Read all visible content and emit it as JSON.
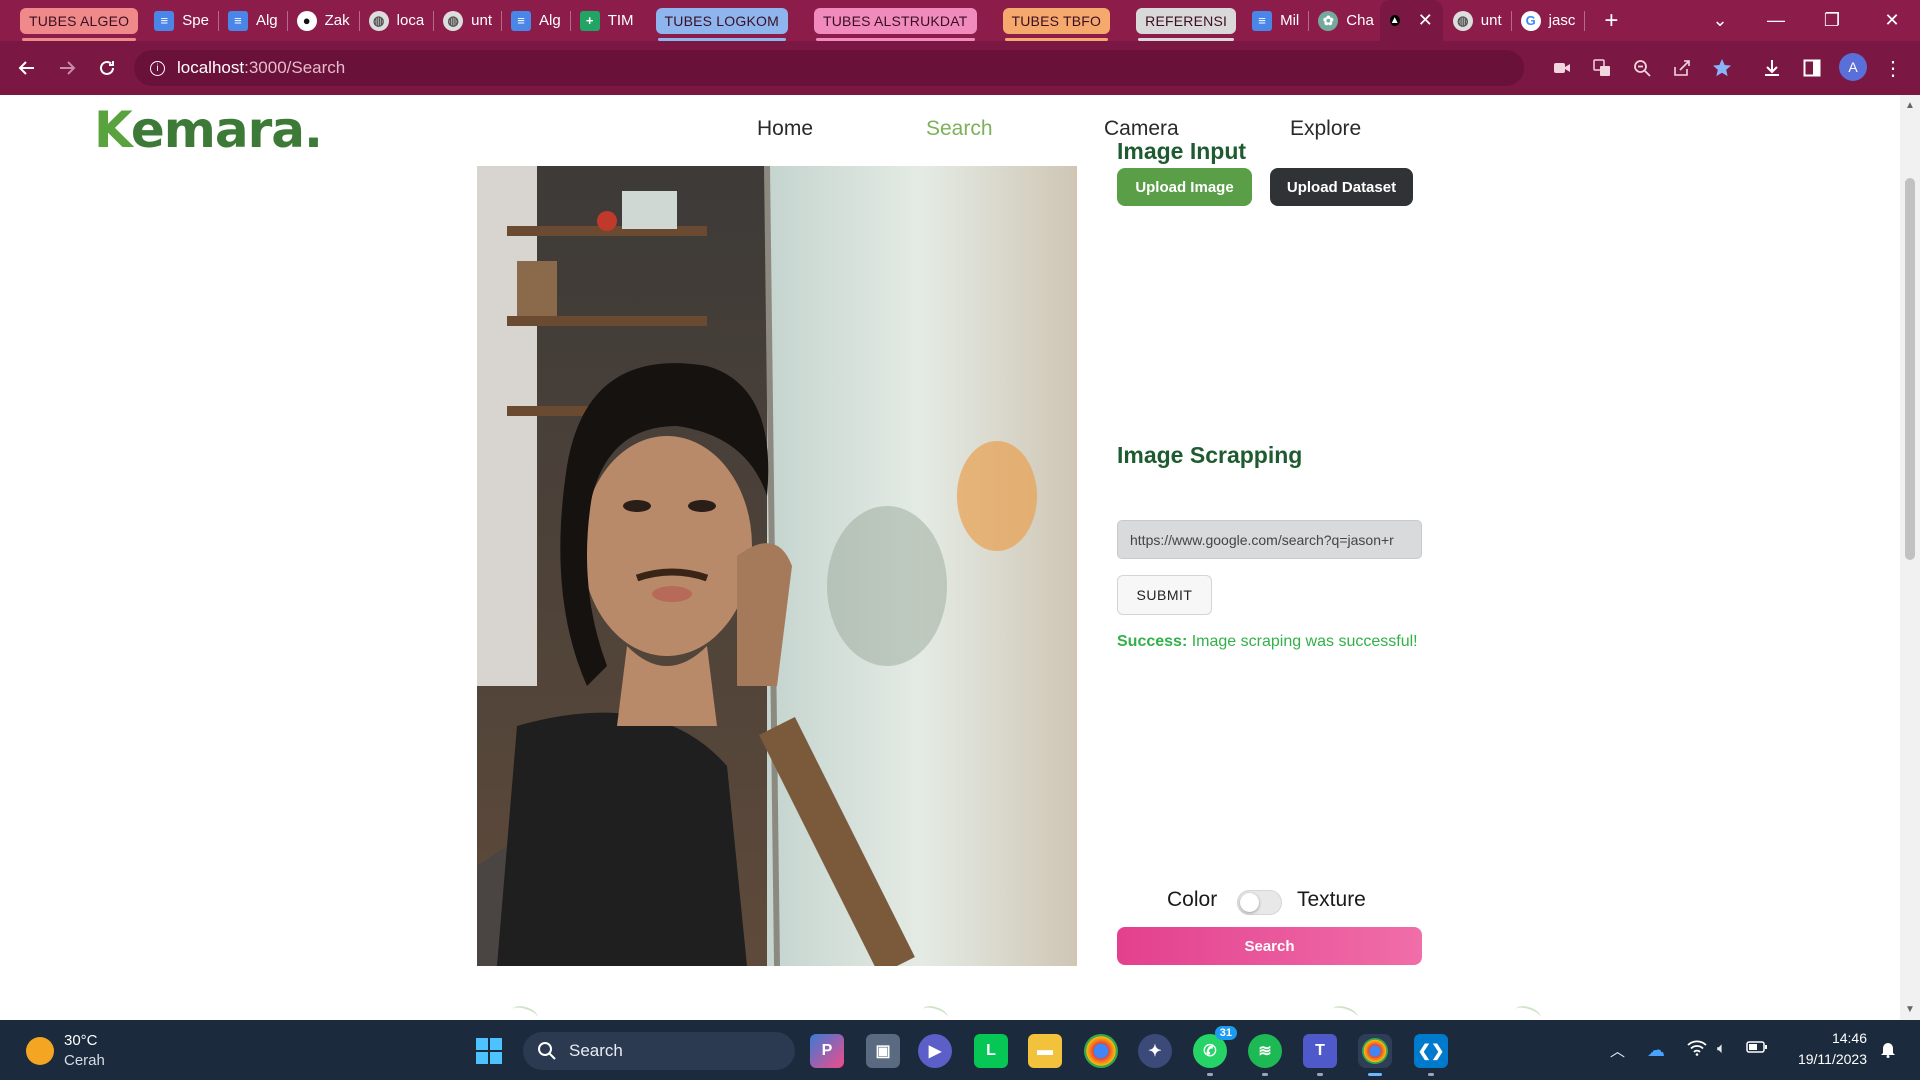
{
  "browser": {
    "tabs": [
      {
        "type": "group",
        "label": "TUBES ALGEO",
        "color": "#f08a8a"
      },
      {
        "type": "tab",
        "icon": "docs-icon",
        "label": "Spe"
      },
      {
        "type": "tab",
        "icon": "docs-icon",
        "label": "Alg"
      },
      {
        "type": "tab",
        "icon": "github-icon",
        "label": "Zak"
      },
      {
        "type": "tab",
        "icon": "globe-icon",
        "label": "loca"
      },
      {
        "type": "tab",
        "icon": "globe-icon",
        "label": "unt"
      },
      {
        "type": "tab",
        "icon": "docs-icon",
        "label": "Alg"
      },
      {
        "type": "tab",
        "icon": "sheets-icon",
        "label": "TIM"
      },
      {
        "type": "group",
        "label": "TUBES LOGKOM",
        "color": "#8fb5ef"
      },
      {
        "type": "group",
        "label": "TUBES ALSTRUKDAT",
        "color": "#f28bbd"
      },
      {
        "type": "group",
        "label": "TUBES TBFO",
        "color": "#f6a96d"
      },
      {
        "type": "group",
        "label": "REFERENSI",
        "color": "#d9d9d9"
      },
      {
        "type": "tab",
        "icon": "docs-icon",
        "label": "Mil"
      },
      {
        "type": "tab",
        "icon": "chatgpt-icon",
        "label": "Cha"
      },
      {
        "type": "tab",
        "icon": "triangle-icon",
        "label": "",
        "active": true
      },
      {
        "type": "tab",
        "icon": "globe-icon",
        "label": "unt"
      },
      {
        "type": "tab",
        "icon": "google-icon",
        "label": "jasc"
      }
    ],
    "url_host": "localhost",
    "url_rest": ":3000/Search",
    "profile_initial": "A"
  },
  "site": {
    "logo_k": "K",
    "logo_rest": "emara.",
    "nav": [
      "Home",
      "Search",
      "Camera",
      "Explore"
    ],
    "active_nav": "Search"
  },
  "main": {
    "image_input_title": "Image Input",
    "upload_image_label": "Upload Image",
    "upload_dataset_label": "Upload Dataset",
    "scrapping_title": "Image Scrapping",
    "scrape_url": "https://www.google.com/search?q=jason+r",
    "submit_label": "SUBMIT",
    "status_prefix": "Success:",
    "status_message": "Image scraping was successful!",
    "toggle_left": "Color",
    "toggle_right": "Texture",
    "toggle_on": false,
    "search_label": "Search"
  },
  "taskbar": {
    "weather_temp": "30°C",
    "weather_desc": "Cerah",
    "search_placeholder": "Search",
    "whatsapp_badge": "31",
    "time": "14:46",
    "date": "19/11/2023"
  },
  "colors": {
    "chrome_tabbar": "#8c1d4a",
    "chrome_toolbar": "#7a1843",
    "brand_green": "#3d7a37",
    "upload_image_btn": "#5a9e48",
    "upload_dataset_btn": "#2f3336",
    "search_btn": "#e74c97",
    "success": "#33b04a"
  }
}
